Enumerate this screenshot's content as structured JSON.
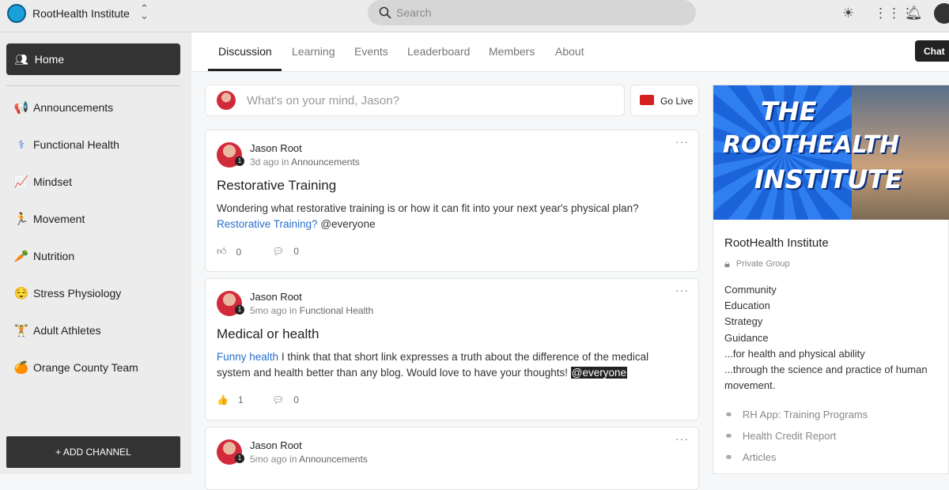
{
  "header": {
    "org_name": "RootHealth Institute",
    "search_placeholder": "Search"
  },
  "sidebar": {
    "home": "Home",
    "channels": [
      {
        "icon": "megaphone-icon",
        "glyph": "📢",
        "label": "Announcements"
      },
      {
        "icon": "caduceus-icon",
        "glyph": "⚕",
        "label": "Functional Health"
      },
      {
        "icon": "chart-icon",
        "glyph": "📈",
        "label": "Mindset"
      },
      {
        "icon": "runner-icon",
        "glyph": "🏃",
        "label": "Movement"
      },
      {
        "icon": "carrot-icon",
        "glyph": "🥕",
        "label": "Nutrition"
      },
      {
        "icon": "face-icon",
        "glyph": "😌",
        "label": "Stress Physiology"
      },
      {
        "icon": "athlete-icon",
        "glyph": "🏋",
        "label": "Adult Athletes"
      },
      {
        "icon": "orange-icon",
        "glyph": "🍊",
        "label": "Orange County Team"
      }
    ],
    "add_channel": "+ ADD CHANNEL"
  },
  "tabs": [
    "Discussion",
    "Learning",
    "Events",
    "Leaderboard",
    "Members",
    "About"
  ],
  "chat_label": "Chat",
  "composer": {
    "placeholder": "What's on your mind, Jason?",
    "go_live": "Go Live"
  },
  "posts": [
    {
      "author": "Jason Root",
      "badge": "1",
      "time": "3d ago",
      "in": "in",
      "channel": "Announcements",
      "title": "Restorative Training",
      "text": "Wondering what restorative training is or how it can fit into your next year's physical plan?",
      "link": "Restorative Training?",
      "mention": "@everyone",
      "likes": "0",
      "comments": "0"
    },
    {
      "author": "Jason Root",
      "badge": "1",
      "time": "5mo ago",
      "in": "in",
      "channel": "Functional Health",
      "title": "Medical or health",
      "link": "Funny health",
      "text": "I think that that short link expresses a truth about the difference of the medical system and health better than any blog. Would love to have your thoughts!",
      "mention": "@everyone",
      "likes": "1",
      "comments": "0"
    },
    {
      "author": "Jason Root",
      "badge": "1",
      "time": "5mo ago",
      "in": "in",
      "channel": "Announcements"
    }
  ],
  "group": {
    "banner_text": [
      "THE",
      "ROOTHEALTH",
      "INSTITUTE"
    ],
    "name": "RootHealth Institute",
    "privacy": "Private Group",
    "description": [
      "Community",
      "Education",
      "Strategy",
      "Guidance",
      "...for health and physical ability",
      "...through the science and practice of human movement."
    ],
    "links": [
      "RH App: Training Programs",
      "Health Credit Report",
      "Articles"
    ]
  }
}
